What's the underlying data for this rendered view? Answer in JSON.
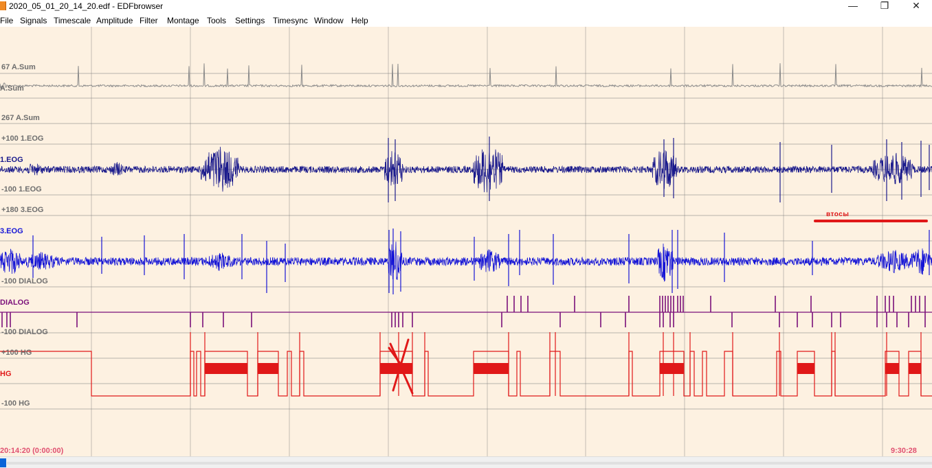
{
  "window": {
    "title": "2020_05_01_20_14_20.edf - EDFbrowser",
    "minimize_glyph": "—",
    "maximize_glyph": "❐",
    "close_glyph": "✕"
  },
  "menu": [
    "File",
    "Signals",
    "Timescale",
    "Amplitude",
    "Filter",
    "Montage",
    "Tools",
    "Settings",
    "Timesync",
    "Window",
    "Help"
  ],
  "signals": {
    "asum": {
      "top": "67 A.Sum",
      "name": "A.Sum",
      "bottom": "267 A.Sum"
    },
    "eog1": {
      "top": "+100 1.EOG",
      "name": "1.EOG",
      "bottom": "-100 1.EOG"
    },
    "eog3": {
      "top": "+180 3.EOG",
      "name": "3.EOG",
      "bottom": "-100 DIALOG"
    },
    "dialog": {
      "name": "DIALOG",
      "bottom": "-100 DIALOG"
    },
    "hg": {
      "top": "+100 HG",
      "name": "HG",
      "bottom": "-100 HG"
    }
  },
  "annotation": {
    "text": "втосы"
  },
  "timeline": {
    "start": "20:14:20 (0:00:00)",
    "end": "9:30:28"
  },
  "colors": {
    "background": "#fdf1e1",
    "grid": "#7a7a7a",
    "asum": "#8a8a8a",
    "eog1": "#1a1a8c",
    "eog3": "#1515d6",
    "dialog": "#7a0f7a",
    "hg": "#e01818"
  }
}
